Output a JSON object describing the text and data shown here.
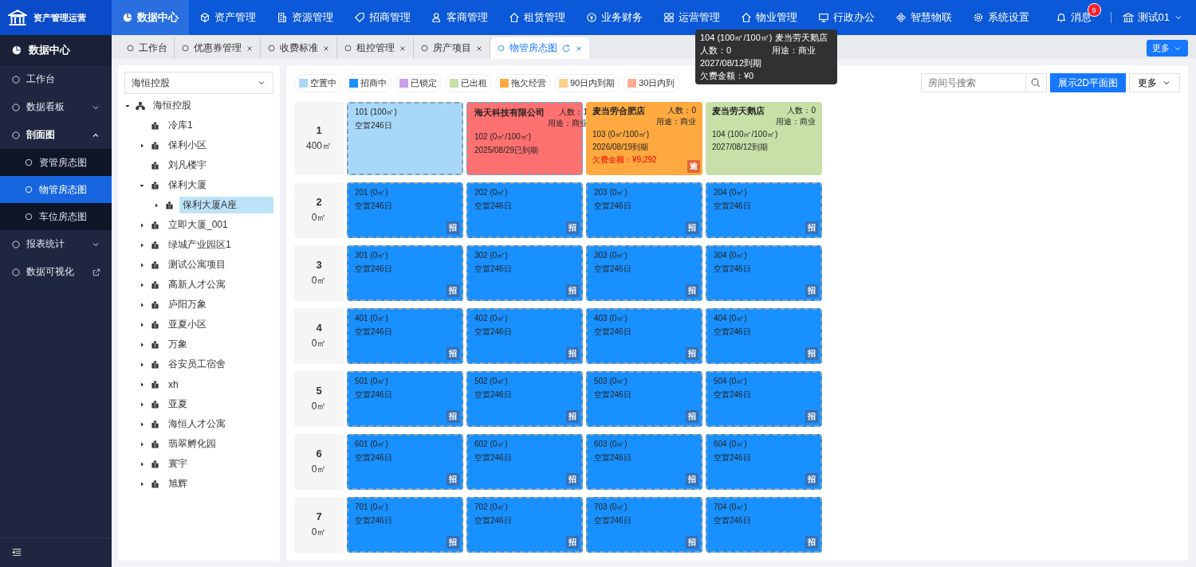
{
  "app": {
    "title": "资产管理运营"
  },
  "top_nav": [
    {
      "label": "数据中心",
      "selected": true
    },
    {
      "label": "资产管理",
      "selected": false
    },
    {
      "label": "资源管理",
      "selected": false
    },
    {
      "label": "招商管理",
      "selected": false
    },
    {
      "label": "客商管理",
      "selected": false
    },
    {
      "label": "租赁管理",
      "selected": false
    },
    {
      "label": "业务财务",
      "selected": false
    },
    {
      "label": "运营管理",
      "selected": false
    },
    {
      "label": "物业管理",
      "selected": false
    },
    {
      "label": "行政办公",
      "selected": false
    },
    {
      "label": "智慧物联",
      "selected": false
    },
    {
      "label": "系统设置",
      "selected": false
    }
  ],
  "messages": {
    "label": "消息",
    "count": "9"
  },
  "user": {
    "name": "测试01"
  },
  "tabs": [
    {
      "label": "工作台",
      "closable": false,
      "selected": false
    },
    {
      "label": "优惠券管理",
      "closable": true,
      "selected": false
    },
    {
      "label": "收费标准",
      "closable": true,
      "selected": false
    },
    {
      "label": "租控管理",
      "closable": true,
      "selected": false
    },
    {
      "label": "房产项目",
      "closable": true,
      "selected": false
    },
    {
      "label": "物管房态图",
      "closable": true,
      "selected": true
    }
  ],
  "tabs_more": "更多",
  "sidebar": {
    "title": "数据中心",
    "items": [
      {
        "label": "工作台",
        "expandable": false,
        "expanded": false,
        "external": false
      },
      {
        "label": "数据看板",
        "expandable": true,
        "expanded": false,
        "external": false
      },
      {
        "label": "剖面图",
        "expandable": true,
        "expanded": true,
        "external": false,
        "children": [
          {
            "label": "资管房态图",
            "selected": false
          },
          {
            "label": "物管房态图",
            "selected": true
          },
          {
            "label": "车位房态图",
            "selected": false
          }
        ]
      },
      {
        "label": "报表统计",
        "expandable": true,
        "expanded": false,
        "external": false
      },
      {
        "label": "数据可视化",
        "expandable": false,
        "expanded": false,
        "external": true
      }
    ]
  },
  "tree": {
    "select_value": "海恒控股",
    "root": {
      "label": "海恒控股",
      "expanded": true,
      "children": [
        {
          "label": "冷库1",
          "has_children": false,
          "selected": false
        },
        {
          "label": "保利小区",
          "has_children": true,
          "expanded": false,
          "selected": false
        },
        {
          "label": "刘凡楼宇",
          "has_children": false,
          "selected": false
        },
        {
          "label": "保利大厦",
          "has_children": true,
          "expanded": true,
          "selected": false,
          "children": [
            {
              "label": "保利大厦A座",
              "has_children": true,
              "expanded": false,
              "selected": true
            }
          ]
        },
        {
          "label": "立即大厦_001",
          "has_children": true,
          "expanded": false,
          "selected": false
        },
        {
          "label": "绿城产业园区1",
          "has_children": true,
          "expanded": false,
          "selected": false
        },
        {
          "label": "测试公寓项目",
          "has_children": true,
          "expanded": false,
          "selected": false
        },
        {
          "label": "高新人才公寓",
          "has_children": true,
          "expanded": false,
          "selected": false
        },
        {
          "label": "庐阳万象",
          "has_children": true,
          "expanded": false,
          "selected": false
        },
        {
          "label": "亚夏小区",
          "has_children": true,
          "expanded": false,
          "selected": false
        },
        {
          "label": "万象",
          "has_children": true,
          "expanded": false,
          "selected": false
        },
        {
          "label": "谷安员工宿舍",
          "has_children": true,
          "expanded": false,
          "selected": false
        },
        {
          "label": "xh",
          "has_children": true,
          "expanded": false,
          "selected": false
        },
        {
          "label": "亚夏",
          "has_children": true,
          "expanded": false,
          "selected": false
        },
        {
          "label": "海恒人才公寓",
          "has_children": true,
          "expanded": false,
          "selected": false
        },
        {
          "label": "翡翠孵化园",
          "has_children": true,
          "expanded": false,
          "selected": false
        },
        {
          "label": "寰宇",
          "has_children": true,
          "expanded": false,
          "selected": false
        },
        {
          "label": "旭辉",
          "has_children": true,
          "expanded": false,
          "selected": false
        }
      ]
    }
  },
  "legend": [
    {
      "label": "空置中",
      "color": "#a8d8f8"
    },
    {
      "label": "招商中",
      "color": "#1890ff"
    },
    {
      "label": "已锁定",
      "color": "#c9a0ec"
    },
    {
      "label": "已出租",
      "color": "#c6e0a8"
    },
    {
      "label": "拖欠经营",
      "color": "#ffa940"
    },
    {
      "label": "90日内到期",
      "color": "#ffd08a"
    },
    {
      "label": "30日内到",
      "color": "#ffab91"
    }
  ],
  "search": {
    "placeholder": "房间号搜索"
  },
  "buttons": {
    "show_2d": "展示2D平面图",
    "more": "更多"
  },
  "floors": [
    {
      "floor": "1",
      "area": "400㎡",
      "rooms": [
        {
          "kind": "vacant",
          "number": "101 (100㎡)",
          "note": "空置246日"
        },
        {
          "kind": "expired",
          "tenant": "海天科技有限公司",
          "people": "人数：1",
          "usage": "用途：商业",
          "number": "102 (0㎡/100㎡)",
          "date": "2025/08/29已到期"
        },
        {
          "kind": "arrears",
          "tenant": "麦当劳合肥店",
          "people": "人数：0",
          "usage": "用途：商业",
          "number": "103 (0㎡/100㎡)",
          "date": "2026/08/19到期",
          "debt": "欠费金额：¥9,292",
          "badge": "逾"
        },
        {
          "kind": "rented",
          "tenant": "麦当劳天鹅店",
          "people": "人数：0",
          "usage": "用途：商业",
          "number": "104 (100㎡/100㎡)",
          "date": "2027/08/12到期"
        }
      ]
    },
    {
      "floor": "2",
      "area": "0㎡",
      "rooms": [
        {
          "kind": "leasing",
          "number": "201 (0㎡)",
          "note": "空置246日",
          "badge": "招"
        },
        {
          "kind": "leasing",
          "number": "202 (0㎡)",
          "note": "空置246日",
          "badge": "招"
        },
        {
          "kind": "leasing",
          "number": "203 (0㎡)",
          "note": "空置246日",
          "badge": "招"
        },
        {
          "kind": "leasing",
          "number": "204 (0㎡)",
          "note": "空置246日",
          "badge": "招"
        }
      ]
    },
    {
      "floor": "3",
      "area": "0㎡",
      "rooms": [
        {
          "kind": "leasing",
          "number": "301 (0㎡)",
          "note": "空置246日",
          "badge": "招"
        },
        {
          "kind": "leasing",
          "number": "302 (0㎡)",
          "note": "空置246日",
          "badge": "招"
        },
        {
          "kind": "leasing",
          "number": "303 (0㎡)",
          "note": "空置246日",
          "badge": "招"
        },
        {
          "kind": "leasing",
          "number": "304 (0㎡)",
          "note": "空置246日",
          "badge": "招"
        }
      ]
    },
    {
      "floor": "4",
      "area": "0㎡",
      "rooms": [
        {
          "kind": "leasing",
          "number": "401 (0㎡)",
          "note": "空置246日",
          "badge": "招"
        },
        {
          "kind": "leasing",
          "number": "402 (0㎡)",
          "note": "空置246日",
          "badge": "招"
        },
        {
          "kind": "leasing",
          "number": "403 (0㎡)",
          "note": "空置246日",
          "badge": "招"
        },
        {
          "kind": "leasing",
          "number": "404 (0㎡)",
          "note": "空置246日",
          "badge": "招"
        }
      ]
    },
    {
      "floor": "5",
      "area": "0㎡",
      "rooms": [
        {
          "kind": "leasing",
          "number": "501 (0㎡)",
          "note": "空置246日",
          "badge": "招"
        },
        {
          "kind": "leasing",
          "number": "502 (0㎡)",
          "note": "空置246日",
          "badge": "招"
        },
        {
          "kind": "leasing",
          "number": "503 (0㎡)",
          "note": "空置246日",
          "badge": "招"
        },
        {
          "kind": "leasing",
          "number": "504 (0㎡)",
          "note": "空置246日",
          "badge": "招"
        }
      ]
    },
    {
      "floor": "6",
      "area": "0㎡",
      "rooms": [
        {
          "kind": "leasing",
          "number": "601 (0㎡)",
          "note": "空置246日",
          "badge": "招"
        },
        {
          "kind": "leasing",
          "number": "602 (0㎡)",
          "note": "空置246日",
          "badge": "招"
        },
        {
          "kind": "leasing",
          "number": "603 (0㎡)",
          "note": "空置246日",
          "badge": "招"
        },
        {
          "kind": "leasing",
          "number": "604 (0㎡)",
          "note": "空置246日",
          "badge": "招"
        }
      ]
    },
    {
      "floor": "7",
      "area": "0㎡",
      "rooms": [
        {
          "kind": "leasing",
          "number": "701 (0㎡)",
          "note": "空置246日",
          "badge": "招"
        },
        {
          "kind": "leasing",
          "number": "702 (0㎡)",
          "note": "空置246日",
          "badge": "招"
        },
        {
          "kind": "leasing",
          "number": "703 (0㎡)",
          "note": "空置246日",
          "badge": "招"
        },
        {
          "kind": "leasing",
          "number": "704 (0㎡)",
          "note": "空置246日",
          "badge": "招"
        }
      ]
    }
  ],
  "tooltip": {
    "title": "104 (100㎡/100㎡)   麦当劳天鹅店",
    "people": "人数：0",
    "usage": "用途：商业",
    "date": "2027/08/12到期",
    "debt": "欠费金额：¥0"
  }
}
